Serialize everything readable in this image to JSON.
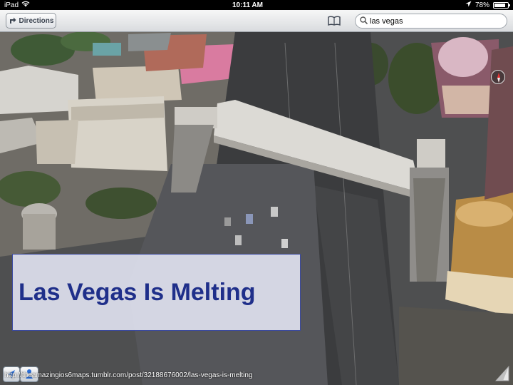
{
  "status_bar": {
    "device": "iPad",
    "time": "10:11 AM",
    "battery": "78%",
    "battery_level": 0.78,
    "icons": [
      "wifi-icon",
      "location-arrow-icon",
      "battery-icon"
    ]
  },
  "toolbar": {
    "directions_label": "Directions",
    "bookmarks_icon": "book-icon",
    "search": {
      "value": "las vegas",
      "icon": "search-icon"
    }
  },
  "map": {
    "compass_icon": "compass-icon",
    "locate_icon": "location-arrow-icon",
    "mode_icon": "people-icon",
    "page_curl_icon": "page-curl-icon"
  },
  "caption": {
    "text": "Las Vegas Is Melting"
  },
  "source_url": "http://theamazingios6maps.tumblr.com/post/32188676002/las-vegas-is-melting"
}
